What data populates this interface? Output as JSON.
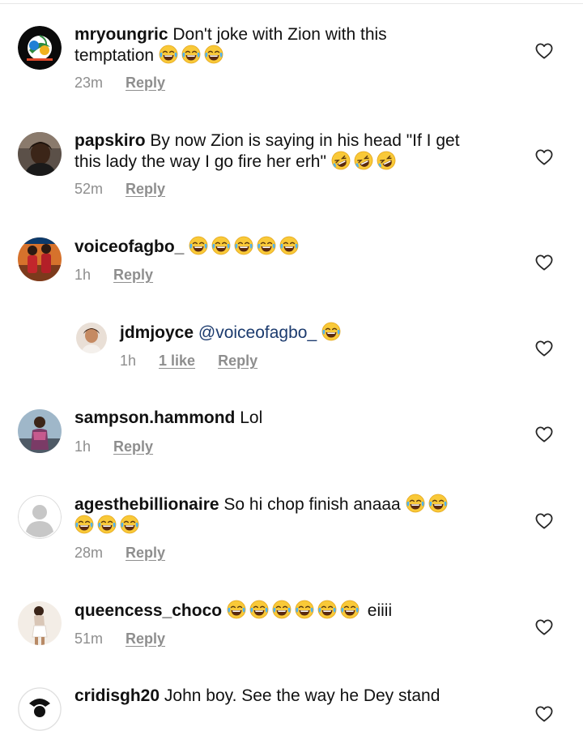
{
  "comments": [
    {
      "username": "mryoungric",
      "text": "Don't joke with Zion with this",
      "text2": "temptation",
      "emojis": [
        "😂",
        "😂",
        "😂"
      ],
      "time": "23m",
      "reply": "Reply",
      "avatar": "logo"
    },
    {
      "username": "papskiro",
      "text": "By now Zion is saying in his head \"If I get",
      "text2": "this lady the way I go fire her erh\"",
      "emojis": [
        "🤣",
        "🤣",
        "🤣"
      ],
      "time": "52m",
      "reply": "Reply",
      "avatar": "photo"
    },
    {
      "username": "voiceofagbo_",
      "text": "",
      "emojis": [
        "😂",
        "😂",
        "😂",
        "😂",
        "😂"
      ],
      "time": "1h",
      "reply": "Reply",
      "avatar": "photo"
    },
    {
      "username": "jdmjoyce",
      "mention": "@voiceofagbo_",
      "emojis": [
        "😂"
      ],
      "time": "1h",
      "likes": "1 like",
      "reply": "Reply",
      "avatar": "photo",
      "is_reply": true
    },
    {
      "username": "sampson.hammond",
      "text": "Lol",
      "time": "1h",
      "reply": "Reply",
      "avatar": "photo"
    },
    {
      "username": "agesthebillionaire",
      "text": "So hi chop finish anaaa",
      "emojis": [
        "😂",
        "😂"
      ],
      "emojis2": [
        "😂",
        "😂",
        "😂"
      ],
      "time": "28m",
      "reply": "Reply",
      "avatar": "default"
    },
    {
      "username": "queencess_choco",
      "text": "",
      "emojis": [
        "😂",
        "😂",
        "😂",
        "😂",
        "😂",
        "😂"
      ],
      "text_after": "eiiii",
      "time": "51m",
      "reply": "Reply",
      "avatar": "photo"
    },
    {
      "username": "cridisgh20",
      "text": "John boy. See the way he Dey stand",
      "avatar": "photo"
    }
  ],
  "icons": {
    "like": "heart-outline-icon",
    "emoji_joy": "face-with-tears-of-joy",
    "emoji_rofl": "rolling-on-floor-laughing"
  },
  "colors": {
    "text": "#111111",
    "meta": "#8e8e8e",
    "mention": "#1c3b6e",
    "emoji": "#f7c733"
  }
}
